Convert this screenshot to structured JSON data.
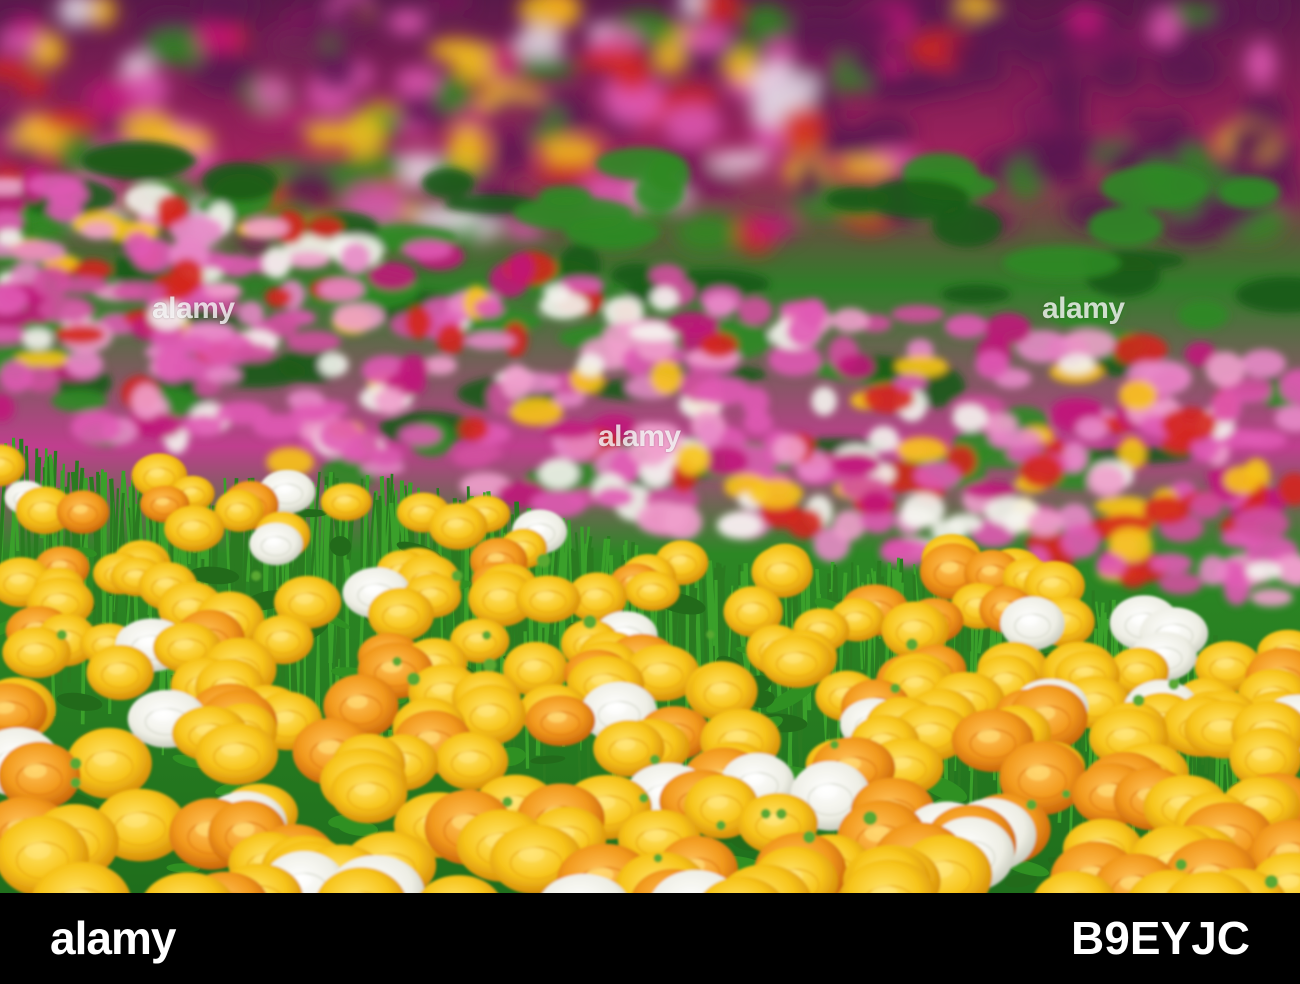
{
  "photo": {
    "subject": "field of ranunculus flowers",
    "palette": {
      "yellow": "#f7c41a",
      "orange": "#f29a1c",
      "pink": "#e05ab4",
      "magenta": "#c0167a",
      "red": "#d4261c",
      "white": "#f4f4ee",
      "green": "#2e8a22",
      "dark_green": "#1b5a18",
      "purple": "#5a1450"
    }
  },
  "watermarks": [
    "alamy",
    "alamy",
    "alamy"
  ],
  "footer": {
    "brand": "alamy",
    "image_id": "B9EYJC"
  }
}
